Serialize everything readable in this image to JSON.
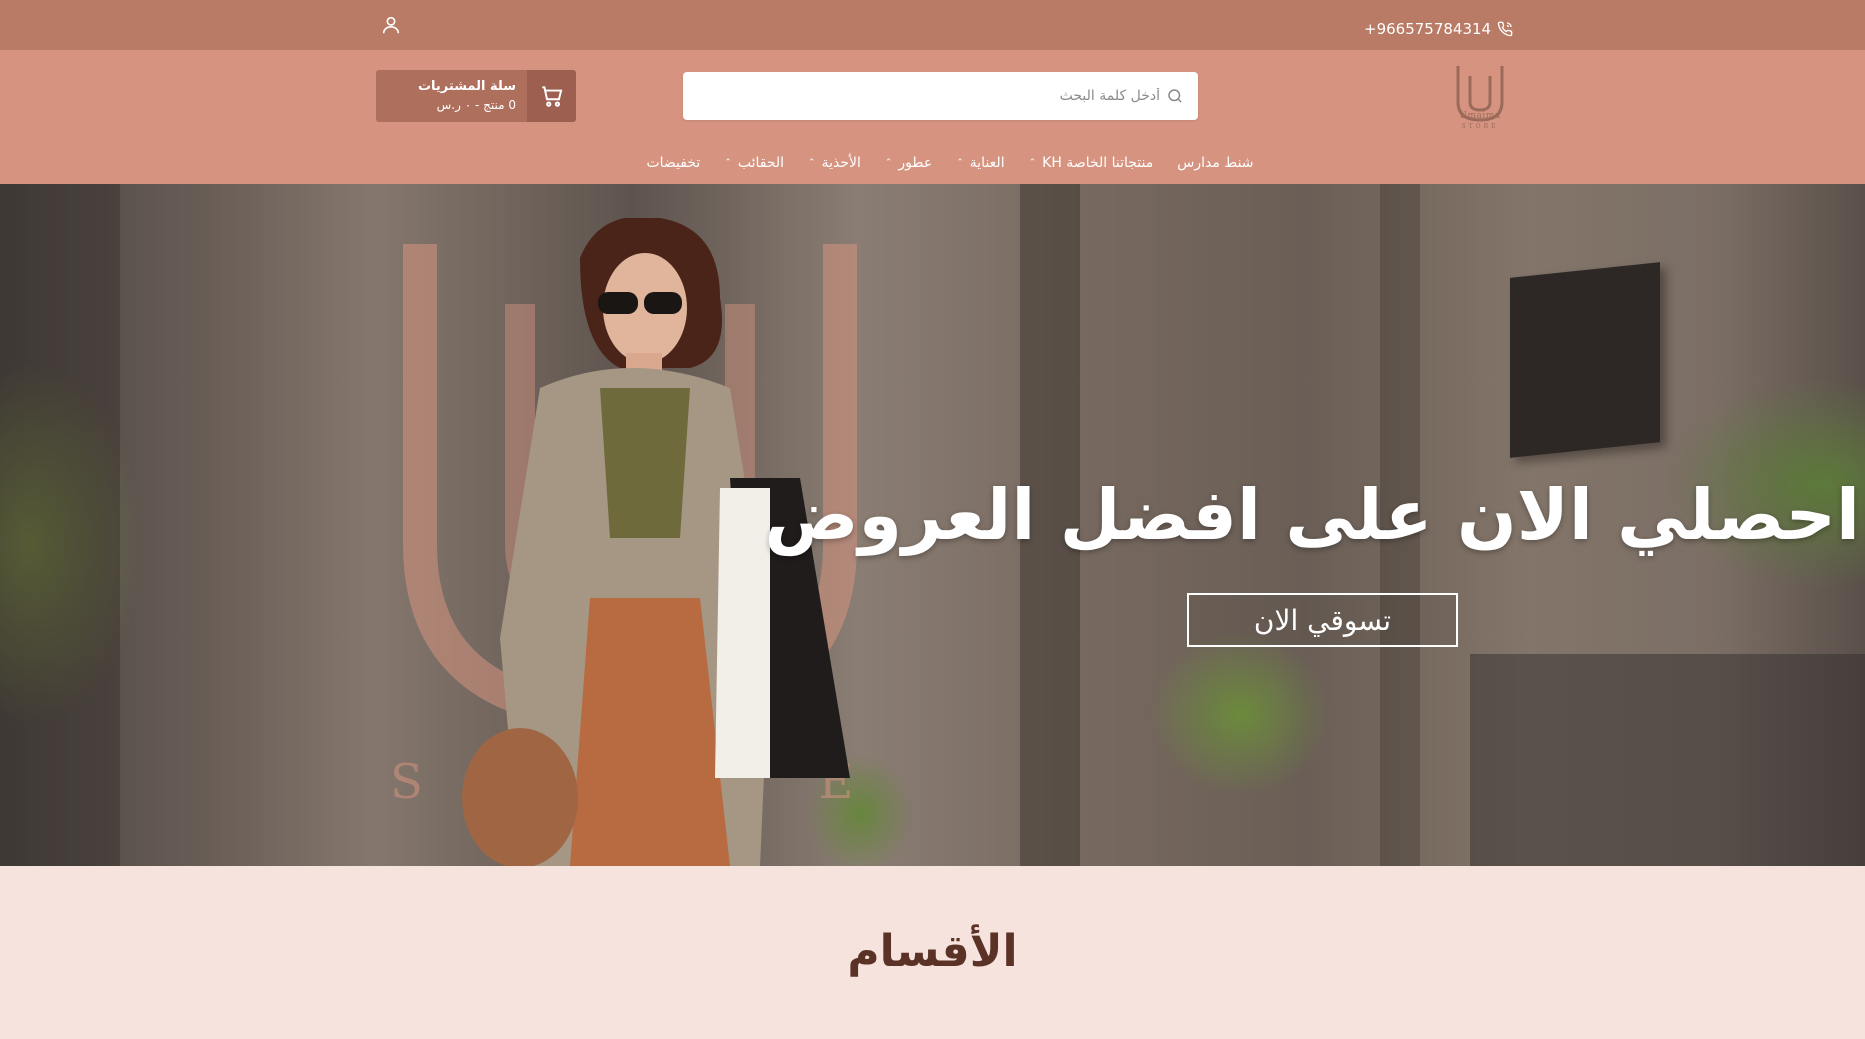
{
  "topbar": {
    "phone": "+966575784314",
    "phone_icon": "phone-icon",
    "user_icon": "user-icon",
    "bg_color": "#b97a66"
  },
  "header": {
    "bg_color": "#d69480",
    "logo_text": "Umaima",
    "logo_sub": "STORE",
    "search": {
      "placeholder": "أدخل كلمة البحث"
    },
    "cart": {
      "title": "سلة المشتريات",
      "summary": "0 منتج - ٠ ر.س",
      "icon": "cart-icon"
    }
  },
  "nav": {
    "items": [
      {
        "label": "تخفيضات",
        "has_dropdown": false
      },
      {
        "label": "الحقائب",
        "has_dropdown": true
      },
      {
        "label": "الأحذية",
        "has_dropdown": true
      },
      {
        "label": "عطور",
        "has_dropdown": true
      },
      {
        "label": "العناية",
        "has_dropdown": true
      },
      {
        "label": "منتجاتنا الخاصة KH",
        "has_dropdown": true
      },
      {
        "label": "شنط مدارس",
        "has_dropdown": false
      }
    ]
  },
  "hero": {
    "headline": "احصلي الان على افضل العروض",
    "cta": "تسوقي الان",
    "watermark": "STORE"
  },
  "categories": {
    "title": "الأقسام",
    "bg_color": "#f6e3dd"
  }
}
